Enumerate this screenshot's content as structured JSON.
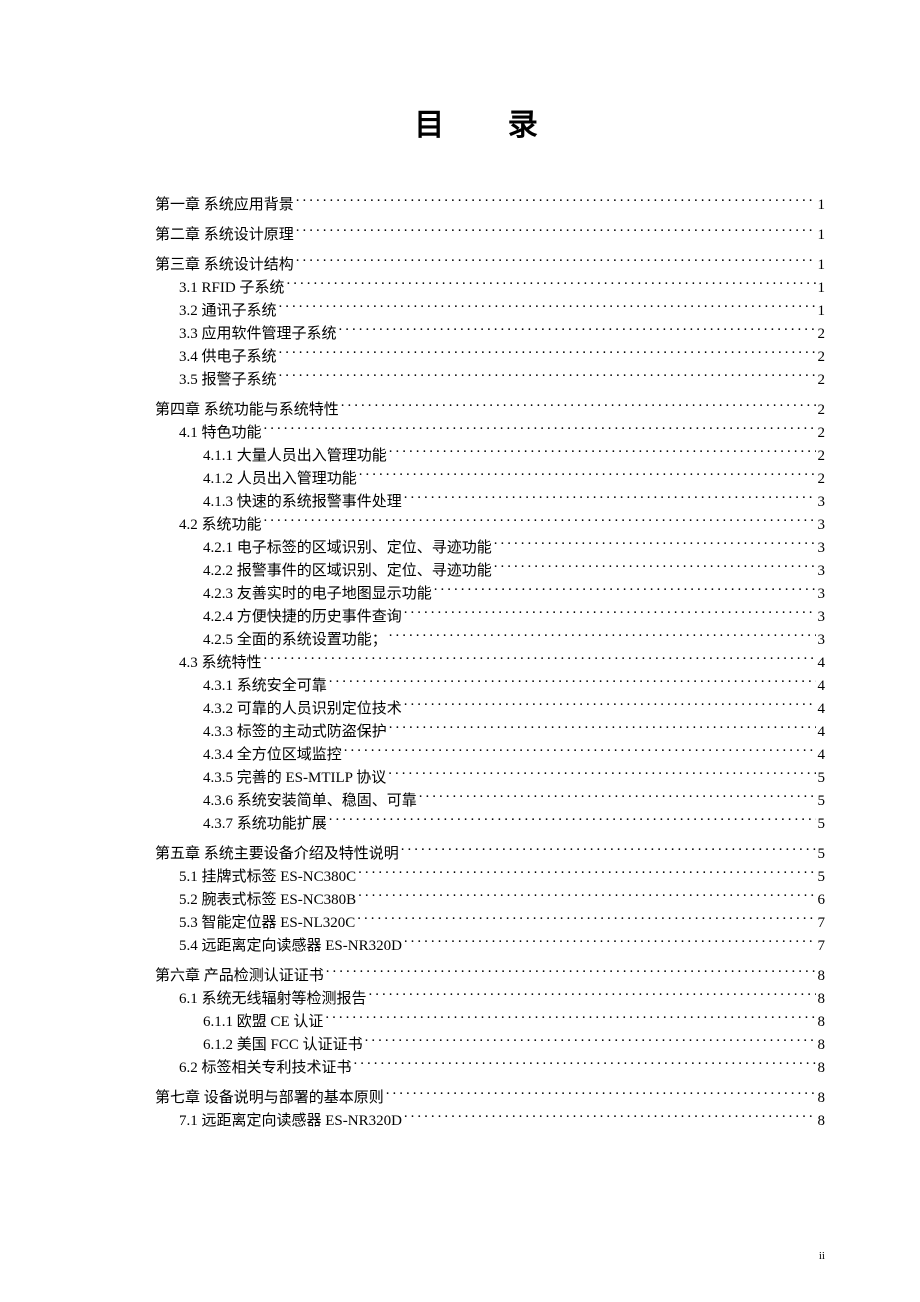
{
  "title": "目 录",
  "page_number": "ii",
  "blocks": [
    {
      "entries": [
        {
          "level": 0,
          "text": "第一章  系统应用背景",
          "page": "1"
        }
      ]
    },
    {
      "entries": [
        {
          "level": 0,
          "text": "第二章  系统设计原理",
          "page": "1"
        }
      ]
    },
    {
      "entries": [
        {
          "level": 0,
          "text": "第三章  系统设计结构",
          "page": "1"
        },
        {
          "level": 1,
          "text": "3.1 RFID 子系统",
          "page": "1"
        },
        {
          "level": 1,
          "text": "3.2  通讯子系统",
          "page": "1"
        },
        {
          "level": 1,
          "text": "3.3  应用软件管理子系统",
          "page": "2"
        },
        {
          "level": 1,
          "text": "3.4  供电子系统",
          "page": "2"
        },
        {
          "level": 1,
          "text": "3.5  报警子系统",
          "page": "2"
        }
      ]
    },
    {
      "entries": [
        {
          "level": 0,
          "text": "第四章  系统功能与系统特性",
          "page": "2"
        },
        {
          "level": 1,
          "text": "4.1  特色功能",
          "page": "2"
        },
        {
          "level": 2,
          "text": "4.1.1  大量人员出入管理功能",
          "page": "2"
        },
        {
          "level": 2,
          "text": "4.1.2  人员出入管理功能",
          "page": "2"
        },
        {
          "level": 2,
          "text": "4.1.3 快速的系统报警事件处理",
          "page": "3"
        },
        {
          "level": 1,
          "text": "4.2  系统功能",
          "page": "3"
        },
        {
          "level": 2,
          "text": "4.2.1  电子标签的区域识别、定位、寻迹功能",
          "page": "3"
        },
        {
          "level": 2,
          "text": "4.2.2  报警事件的区域识别、定位、寻迹功能",
          "page": "3"
        },
        {
          "level": 2,
          "text": "4.2.3  友善实时的电子地图显示功能",
          "page": "3"
        },
        {
          "level": 2,
          "text": "4.2.4  方便快捷的历史事件查询",
          "page": "3"
        },
        {
          "level": 2,
          "text": "4.2.5  全面的系统设置功能；",
          "page": "3"
        },
        {
          "level": 1,
          "text": "4.3  系统特性",
          "page": "4"
        },
        {
          "level": 2,
          "text": "4.3.1  系统安全可靠",
          "page": "4"
        },
        {
          "level": 2,
          "text": "4.3.2 可靠的人员识别定位技术",
          "page": "4"
        },
        {
          "level": 2,
          "text": "4.3.3  标签的主动式防盗保护",
          "page": "4"
        },
        {
          "level": 2,
          "text": "4.3.4  全方位区域监控",
          "page": "4"
        },
        {
          "level": 2,
          "text": "4.3.5  完善的 ES-MTILP 协议",
          "page": "5"
        },
        {
          "level": 2,
          "text": "4.3.6  系统安装简单、稳固、可靠",
          "page": "5"
        },
        {
          "level": 2,
          "text": "4.3.7  系统功能扩展",
          "page": "5"
        }
      ]
    },
    {
      "entries": [
        {
          "level": 0,
          "text": "第五章  系统主要设备介绍及特性说明",
          "page": "5"
        },
        {
          "level": 1,
          "text": "5.1  挂牌式标签    ES-NC380C",
          "page": "5"
        },
        {
          "level": 1,
          "text": "5.2  腕表式标签    ES-NC380B",
          "page": "6"
        },
        {
          "level": 1,
          "text": "5.3  智能定位器    ES-NL320C",
          "page": "7"
        },
        {
          "level": 1,
          "text": "5.4  远距离定向读感器    ES-NR320D",
          "page": "7"
        }
      ]
    },
    {
      "entries": [
        {
          "level": 0,
          "text": "第六章  产品检测认证证书",
          "page": "8"
        },
        {
          "level": 1,
          "text": "6.1  系统无线辐射等检测报告",
          "page": "8"
        },
        {
          "level": 2,
          "text": "6.1.1  欧盟  CE  认证",
          "page": "8"
        },
        {
          "level": 2,
          "text": "6.1.2  美国 FCC 认证证书",
          "page": "8"
        },
        {
          "level": 1,
          "text": "6.2  标签相关专利技术证书",
          "page": "8"
        }
      ]
    },
    {
      "entries": [
        {
          "level": 0,
          "text": "第七章  设备说明与部署的基本原则",
          "page": "8"
        },
        {
          "level": 1,
          "text": "7.1  远距离定向读感器 ES-NR320D",
          "page": "8"
        }
      ]
    }
  ]
}
